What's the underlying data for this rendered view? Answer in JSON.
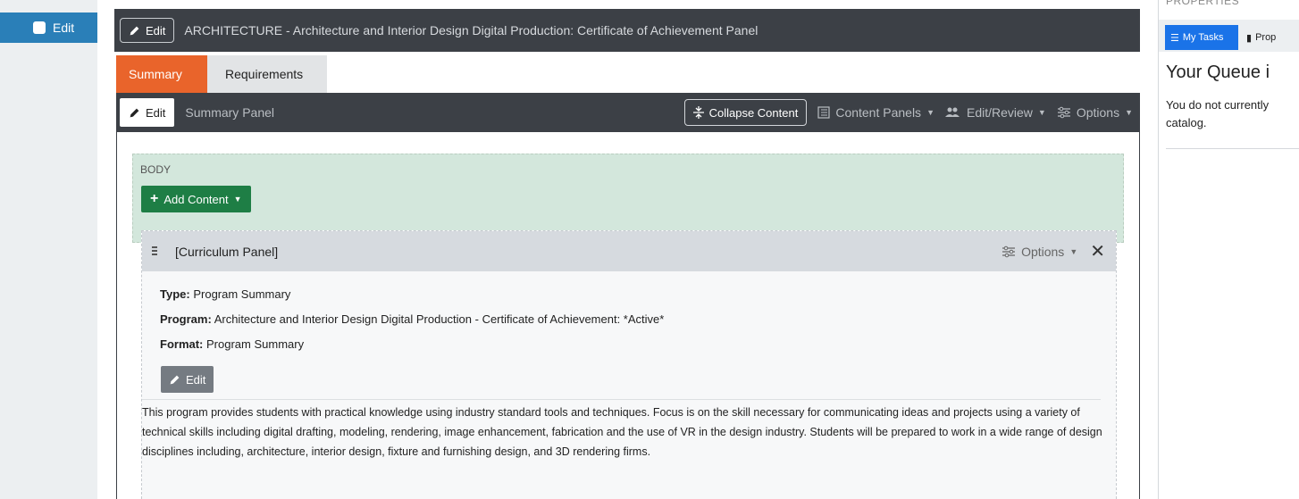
{
  "left_rail": {
    "edit_label": "Edit"
  },
  "title_bar": {
    "edit_label": "Edit",
    "title": "ARCHITECTURE - Architecture and Interior Design Digital Production: Certificate of Achievement Panel"
  },
  "tabs": [
    {
      "label": "Summary",
      "active": true
    },
    {
      "label": "Requirements",
      "active": false
    }
  ],
  "panel_bar": {
    "edit_label": "Edit",
    "title": "Summary Panel",
    "collapse_label": "Collapse Content",
    "content_panels_label": "Content Panels",
    "edit_review_label": "Edit/Review",
    "options_label": "Options"
  },
  "body_region": {
    "label": "BODY",
    "add_content_label": "Add Content"
  },
  "curriculum_panel": {
    "title": "[Curriculum Panel]",
    "options_label": "Options",
    "close_glyph": "✕",
    "type_label": "Type:",
    "type_value": "Program Summary",
    "program_label": "Program:",
    "program_value": "Architecture and Interior Design Digital Production - Certificate of Achievement: *Active*",
    "format_label": "Format:",
    "format_value": "Program Summary",
    "edit_label": "Edit",
    "description": "This program provides students with practical knowledge using industry standard tools and techniques.  Focus is on the skill necessary for communicating ideas and projects using a variety of technical skills including digital drafting, modeling, rendering, image enhancement, fabrication and the use of VR in the design industry. Students will be prepared to work in a wide range of design disciplines including, architecture, interior design, fixture and furnishing design, and 3D rendering firms."
  },
  "right_sidebar": {
    "section_label": "PROPERTIES",
    "tab_my_tasks": "My Tasks",
    "tab_properties": "Prop",
    "queue_title": "Your Queue i",
    "queue_text": "You do not currently catalog."
  },
  "colors": {
    "brand_blue": "#2a7fb8",
    "dark_bar": "#3c4046",
    "active_tab": "#e9642b",
    "body_green": "#d3e7dc",
    "add_button": "#1e7e45",
    "tasks_blue": "#1a73e8"
  }
}
